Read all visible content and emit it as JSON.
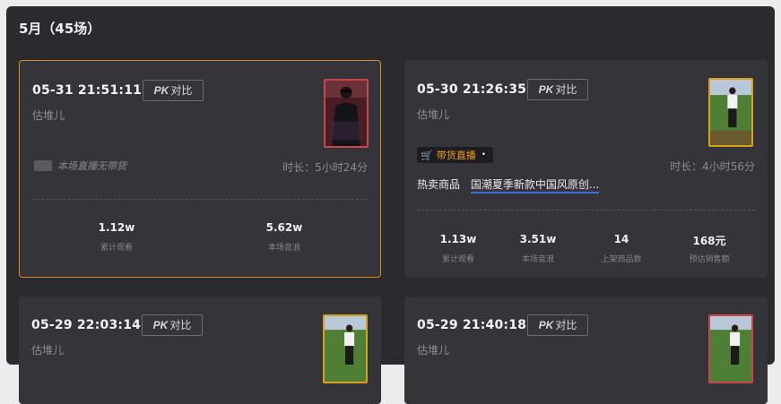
{
  "header": {
    "title": "5月（45场）"
  },
  "cards": [
    {
      "time": "05-31 21:51:11",
      "pk_label": "对比",
      "user": "估堆儿",
      "no_goods": "本场直播无带货",
      "duration": "时长：5小时24分",
      "stats": [
        {
          "value": "1.12w",
          "label": "累计观看"
        },
        {
          "value": "5.62w",
          "label": "本场音浪"
        }
      ]
    },
    {
      "time": "05-30 21:26:35",
      "pk_label": "对比",
      "user": "估堆儿",
      "live_tag": "带货直播",
      "duration": "时长：4小时56分",
      "hot_label": "热卖商品",
      "hot_item": "国潮夏季新款中国风原创...",
      "stats": [
        {
          "value": "1.13w",
          "label": "累计观看"
        },
        {
          "value": "3.51w",
          "label": "本场音浪"
        },
        {
          "value": "14",
          "label": "上架商品数"
        },
        {
          "value": "168元",
          "label": "预估销售额"
        }
      ]
    },
    {
      "time": "05-29 22:03:14",
      "pk_label": "对比",
      "user": "估堆儿"
    },
    {
      "time": "05-29 21:40:18",
      "pk_label": "对比",
      "user": "估堆儿"
    }
  ],
  "pk_prefix": "PK",
  "icons": {
    "cart": "shopping-cart-icon",
    "no_goods": "box-icon"
  },
  "colors": {
    "accent": "#d98d1d",
    "background": "#2a2a2f",
    "card": "#343439",
    "link_underline": "#3d6fd8"
  }
}
